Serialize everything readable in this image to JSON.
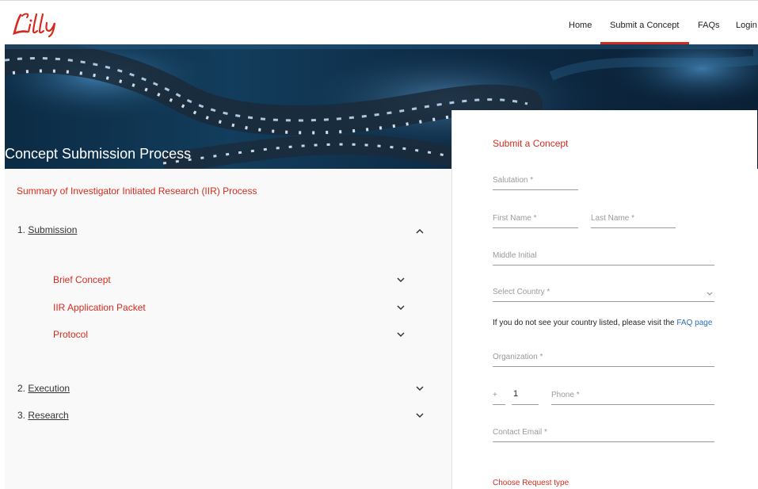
{
  "header": {
    "logo_text": "Lilly",
    "nav": [
      {
        "label": "Home"
      },
      {
        "label": "Submit a Concept"
      },
      {
        "label": "FAQs"
      },
      {
        "label": "Login"
      }
    ],
    "active_nav": "Submit a Concept"
  },
  "hero": {
    "title": "Concept Submission Process"
  },
  "summary": {
    "title": "Summary of Investigator Initiated Research (IIR) Process",
    "sections": [
      {
        "number": "1.",
        "label": "Submission",
        "expanded": true,
        "items": [
          {
            "label": "Brief Concept"
          },
          {
            "label": "IIR Application Packet"
          },
          {
            "label": "Protocol"
          }
        ]
      },
      {
        "number": "2.",
        "label": "Execution",
        "expanded": false
      },
      {
        "number": "3.",
        "label": "Research",
        "expanded": false
      }
    ]
  },
  "form": {
    "title": "Submit a Concept",
    "salutation_placeholder": "Salutation *",
    "first_name_placeholder": "First Name *",
    "last_name_placeholder": "Last Name *",
    "middle_initial_placeholder": "Middle Initial",
    "country_placeholder": "Select Country *",
    "country_note": "If you do not see your country listed, please visit the",
    "country_note_link": "FAQ page",
    "organization_placeholder": "Organization *",
    "phone_prefix": "+",
    "phone_code": "1",
    "phone_placeholder": "Phone *",
    "email_placeholder": "Contact Email *",
    "request_type_title": "Choose Request type"
  },
  "colors": {
    "brand_red": "#d52b1e",
    "link_blue": "#2a6db5",
    "hero_dark_blue": "#0c2b44"
  }
}
